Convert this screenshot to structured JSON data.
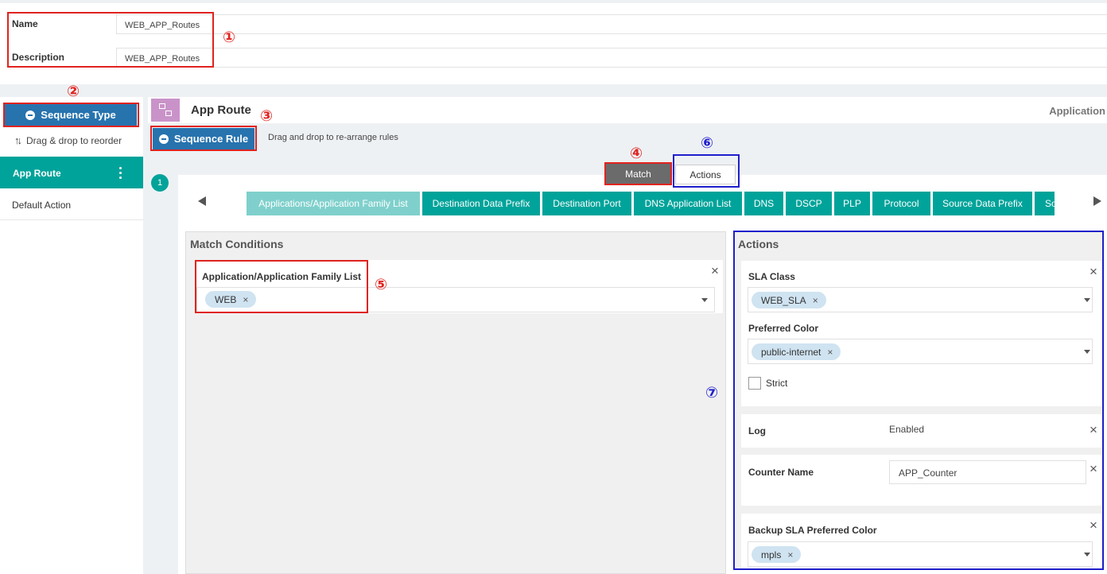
{
  "form": {
    "name_label": "Name",
    "name_value": "WEB_APP_Routes",
    "description_label": "Description",
    "description_value": "WEB_APP_Routes"
  },
  "annotations": [
    "①",
    "②",
    "③",
    "④",
    "⑤",
    "⑥",
    "⑦"
  ],
  "sidebar": {
    "sequence_type_label": "Sequence Type",
    "drag_hint": "Drag & drop to reorder",
    "items": [
      {
        "label": "App Route",
        "active": true
      },
      {
        "label": "Default Action",
        "active": false
      }
    ]
  },
  "header": {
    "title": "App Route",
    "right_label": "Application",
    "sequence_rule_label": "Sequence Rule",
    "drag_hint": "Drag and drop to re-arrange rules"
  },
  "rule": {
    "number": "1",
    "match_tab": "Match",
    "actions_tab": "Actions",
    "tabs": [
      "Applications/Application Family List",
      "Destination Data Prefix",
      "Destination Port",
      "DNS Application List",
      "DNS",
      "DSCP",
      "PLP",
      "Protocol",
      "Source Data Prefix",
      "So"
    ]
  },
  "match_conditions": {
    "title": "Match Conditions",
    "field_label": "Application/Application Family List",
    "selected": "WEB"
  },
  "actions": {
    "title": "Actions",
    "sla_class_label": "SLA Class",
    "sla_class_value": "WEB_SLA",
    "preferred_color_label": "Preferred Color",
    "preferred_color_value": "public-internet",
    "strict_label": "Strict",
    "log_label": "Log",
    "log_value": "Enabled",
    "counter_label": "Counter Name",
    "counter_value": "APP_Counter",
    "backup_label": "Backup SLA Preferred Color",
    "backup_value": "mpls"
  },
  "colors": {
    "primary": "#2773ae",
    "teal": "#00a39a",
    "teal_light": "#7fd0cc",
    "annotation_red": "#e0231f",
    "annotation_blue": "#1f1fcc"
  }
}
